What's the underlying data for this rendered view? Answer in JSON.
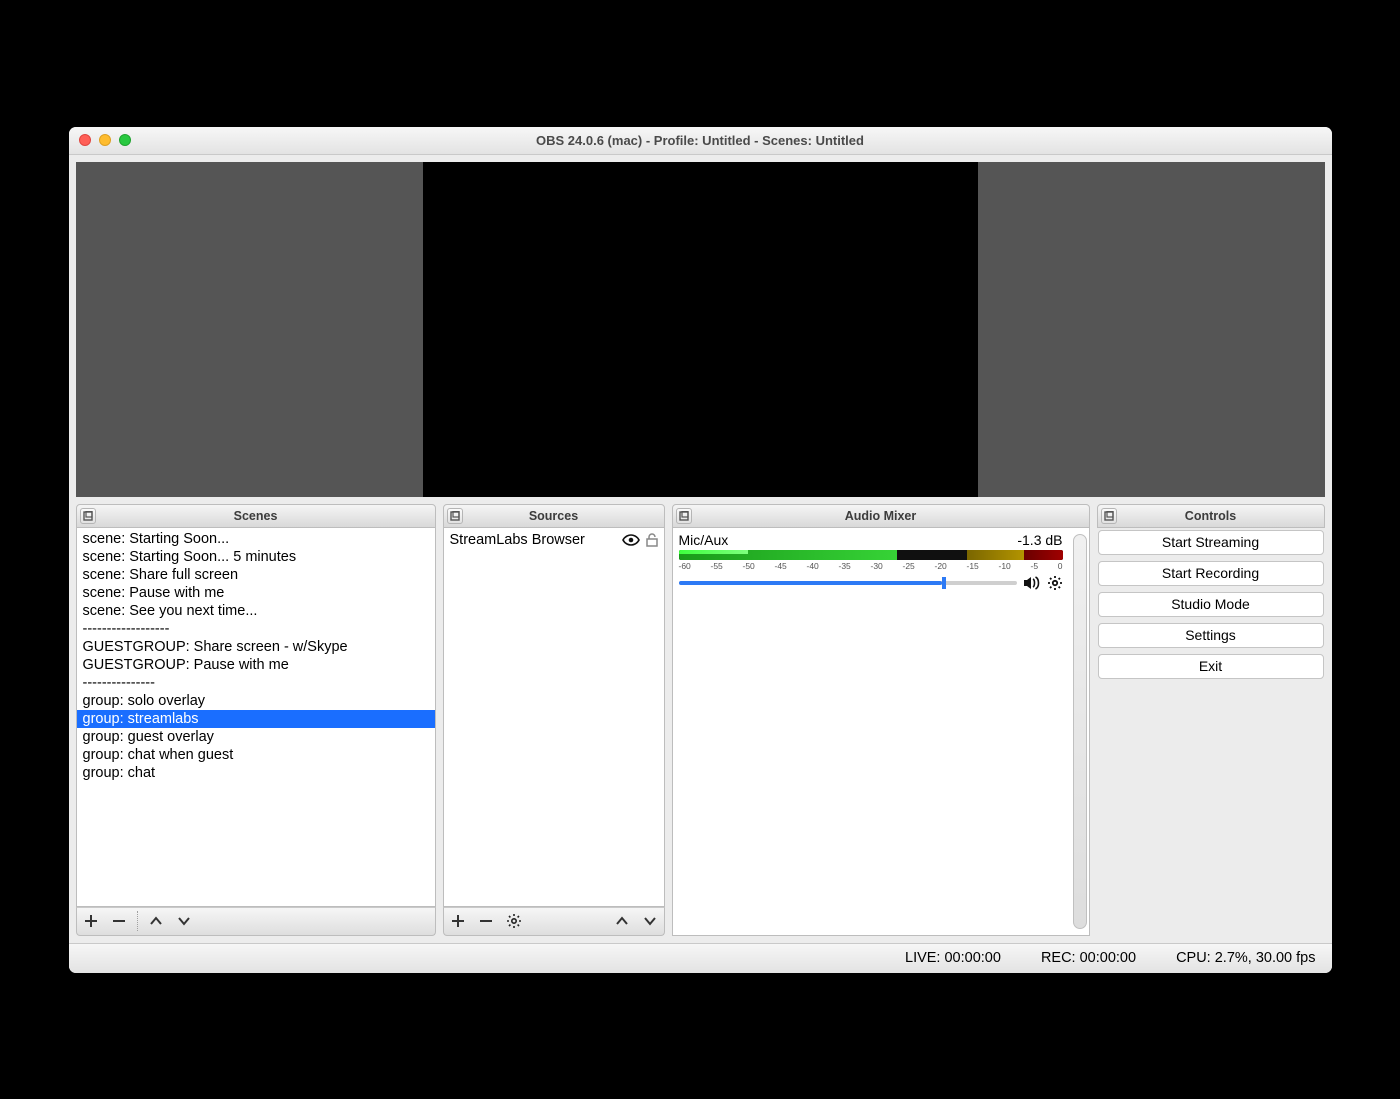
{
  "window": {
    "title": "OBS 24.0.6 (mac) - Profile: Untitled - Scenes: Untitled"
  },
  "panels": {
    "scenes": {
      "title": "Scenes",
      "items": [
        "scene: Starting Soon...",
        "scene: Starting Soon... 5 minutes",
        "scene: Share full screen",
        "scene: Pause with me",
        "scene: See you next time...",
        "------------------",
        "GUESTGROUP: Share screen - w/Skype",
        "GUESTGROUP: Pause with me",
        "---------------",
        "group: solo overlay",
        "group: streamlabs",
        "group: guest overlay",
        "group: chat when guest",
        "group: chat"
      ],
      "selectedIndex": 10
    },
    "sources": {
      "title": "Sources",
      "items": [
        {
          "label": "StreamLabs Browser",
          "visible": true,
          "locked": false
        }
      ]
    },
    "audio": {
      "title": "Audio Mixer",
      "tracks": [
        {
          "name": "Mic/Aux",
          "db_label": "-1.3 dB",
          "ticks": [
            "-60",
            "-55",
            "-50",
            "-45",
            "-40",
            "-35",
            "-30",
            "-25",
            "-20",
            "-15",
            "-10",
            "-5",
            "0"
          ],
          "volume_percent": 78
        }
      ]
    },
    "controls": {
      "title": "Controls",
      "buttons": {
        "start_streaming": "Start Streaming",
        "start_recording": "Start Recording",
        "studio_mode": "Studio Mode",
        "settings": "Settings",
        "exit": "Exit"
      }
    }
  },
  "status": {
    "live": "LIVE: 00:00:00",
    "rec": "REC: 00:00:00",
    "cpu": "CPU: 2.7%, 30.00 fps"
  }
}
